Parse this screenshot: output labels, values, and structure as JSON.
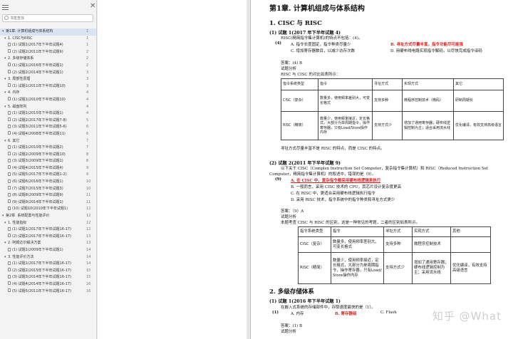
{
  "sidebar": {
    "search_placeholder": "书签查找",
    "toc": [
      {
        "label": "第1章. 计算机组成与体系结构",
        "page": "1",
        "level": 0,
        "tw": "▾",
        "selected": true
      },
      {
        "label": "1. CISC与RISC",
        "page": "1",
        "level": 1,
        "tw": "▾"
      },
      {
        "label": "(1) 试题1(2017年下半年试题4)",
        "page": "1",
        "level": 2
      },
      {
        "label": "(2) 试题2(2011年下半年试题9)",
        "page": "2",
        "level": 2
      },
      {
        "label": "2. 多级存储体系",
        "page": "2",
        "level": 1,
        "tw": "▾"
      },
      {
        "label": "(1) 试题1(2016年下半年试题1)",
        "page": "2",
        "level": 2
      },
      {
        "label": "(2) 试题2(2014年下半年试题1)",
        "page": "3",
        "level": 2
      },
      {
        "label": "3. 局部性原理",
        "page": "3",
        "level": 1,
        "tw": "▾"
      },
      {
        "label": "(1) 试题1(2011年下半年试题10)",
        "page": "3",
        "level": 2
      },
      {
        "label": "4. 内存",
        "page": "4",
        "level": 1,
        "tw": "▾"
      },
      {
        "label": "(1) 试题1(2010年下半年试题10)",
        "page": "4",
        "level": 2
      },
      {
        "label": "5. 磁盘阵列",
        "page": "4",
        "level": 1,
        "tw": "▾"
      },
      {
        "label": "(1) 试题1(2015年下半年试题1)",
        "page": "4",
        "level": 2
      },
      {
        "label": "(2) 试题2(2017年下半年试题7-8)",
        "page": "5",
        "level": 2
      },
      {
        "label": "(3) 试题3(2011年下半年试题5-6)",
        "page": "6",
        "level": 2
      },
      {
        "label": "(4) 试题4(2008年下半年试题11)",
        "page": "6",
        "level": 2
      },
      {
        "label": "6. 其它",
        "page": "7",
        "level": 1,
        "tw": "▾"
      },
      {
        "label": "(1) 试题1(2010年下半年试题2)",
        "page": "7",
        "level": 2
      },
      {
        "label": "(2) 试题2(2009年下半年试题10)",
        "page": "8",
        "level": 2
      },
      {
        "label": "(3) 试题3(2009年下半年试题1)",
        "page": "8",
        "level": 2
      },
      {
        "label": "(4) 试题4(2015年下半年试题4)",
        "page": "9",
        "level": 2
      },
      {
        "label": "(5) 试题5(2017年下半年试题1-2)",
        "page": "9",
        "level": 2
      },
      {
        "label": "(6) 试题6(2016年下半年试题1)",
        "page": "10",
        "level": 2
      },
      {
        "label": "(7) 试题7(2015年下半年试题3)",
        "page": "10",
        "level": 2
      },
      {
        "label": "(8) 试题8(2009年下半年试题9)",
        "page": "11",
        "level": 2
      },
      {
        "label": "(9) 试题9(2014年下半年试题1)",
        "page": "11",
        "level": 2
      },
      {
        "label": "(10) 试题10(2010年下半年试题1)",
        "page": "12",
        "level": 2
      },
      {
        "label": "第2章. 系统配置与性能评价",
        "page": "12",
        "level": 0,
        "tw": "▾"
      },
      {
        "label": "1. 性能指标",
        "page": "12",
        "level": 1,
        "tw": "▾"
      },
      {
        "label": "(1) 试题1(2017年下半年试题16-17)",
        "page": "12",
        "level": 2
      },
      {
        "label": "(2) 试题2(2017年下半年试题16-17)",
        "page": "13",
        "level": 2
      },
      {
        "label": "2. 阿姆达尔解决方案",
        "page": "13",
        "level": 1,
        "tw": "▾"
      },
      {
        "label": "(1) 试题1(2009年下半年试题1)",
        "page": "14",
        "level": 2
      },
      {
        "label": "3. 性能评价方法",
        "page": "14",
        "level": 1,
        "tw": "▾"
      },
      {
        "label": "(1) 试题1(2017年下半年试题16-17)",
        "page": "14",
        "level": 2
      },
      {
        "label": "(2) 试题2(2015年下半年试题16-17)",
        "page": "15",
        "level": 2
      },
      {
        "label": "(3) 试题3(2014年下半年试题16-17)",
        "page": "15",
        "level": 2
      },
      {
        "label": "(4) 试题4(2014年下半年试题16-17)",
        "page": "16",
        "level": 2
      },
      {
        "label": "(5) 试题5(2011年下半年试题16-17)",
        "page": "16",
        "level": 2
      }
    ]
  },
  "doc": {
    "chapter": "第1章. 计算机组成与体系结构",
    "s1_title": "1. CISC 与 RISC",
    "q1_title": "(1) 试题 1(2017 年下半年试题 4)",
    "q1_stem": "RISC(精简指令集计算机)的特点不包括：(4)。",
    "q1_num": "(4)",
    "q1_a": "A. 指令长度固定，指令种类尽量少",
    "q1_b": "B. 寻址方式尽量丰富，指令功能尽可能强",
    "q1_c": "C. 增加寄存器数目，以减少访存次数",
    "q1_d": "D. 用硬布线电路实现指令解码，以尽快完成指令译码",
    "q1_answer": "答案：(4) B",
    "q1_analysis": "试题分析",
    "q1_intro": "RISC 与 CISC 的对比如表所示：",
    "t1_header": [
      "指令系统类型",
      "指令",
      "寻址方式",
      "实现方式",
      "其它"
    ],
    "t1_rows": [
      [
        "CISC（复杂）",
        "数量多，使用频率差别大，可变长格式",
        "支持多种",
        "微程序控制技术（微码）",
        "研制周期长"
      ],
      [
        "RISC（精简）",
        "数量少，使用频率接近，定长格式，大部分为单周期指令，操作寄存器，只有Load/Store操作内存",
        "支持方式少",
        "增加了通用寄存器；硬布线逻辑控制为主；适合采用流水线",
        "优化编译，有效支持高级语言"
      ]
    ],
    "q1_note": "寻址方式尽量丰富不是 RISC 的特点，而是 CISC 的特点。",
    "q2_title": "(2) 试题 2(2011 年下半年试题 9)",
    "q2_stem1": "以下关于 CISC（Complex Instruction Set Computer，复杂指令集计算机）和 RISC（Reduced Instruction Set",
    "q2_stem2": "Computer，精简指令集计算机）的叙述中，错误的是（9）。",
    "q2_num": "(9)",
    "q2_a": "A. 在 CISC 中，复杂指令都采用硬布线逻辑来执行",
    "q2_b": "B. 一般而言，采用 CISC 技术的 CPU，其芯片设计复杂度更高",
    "q2_c": "C. 在 RISC 中，更适合采用硬布线逻辑执行指令",
    "q2_d": "D. 采用 RISC 技术，指令系统中的指令种类和寻址方式更少",
    "q2_answer": "答案：（9）A",
    "q2_analysis": "试题分析",
    "q2_intro": "本题考查 CISC 与 RISC 的区别，这是一种常见的考题，二者的区别如表所示。",
    "t2_header": [
      "指令系统类型",
      "指令",
      "寻址方式",
      "实现方式",
      "其他"
    ],
    "t2_rows": [
      [
        "CISC（复杂）",
        "数量多，使用频率差别大，可变长格式",
        "支持多种",
        "微程序控制技术",
        ""
      ],
      [
        "RISC（精简）",
        "数量少，使用频率接近，定长格式，大部分为单周期指令，操作寄存器，只有Load/Store操作内存",
        "支持方式少",
        "增加了通用寄存器；硬布线逻辑控制为主；采用流水线",
        "优化编译，有效支持高级语言"
      ]
    ],
    "s2_title": "2. 多级存储体系",
    "q3_title": "(1) 试题 1(2016 年下半年试题 1)",
    "q3_stem": "在嵌入式系统的存储部件中，存取速度最快的是（1）。",
    "q3_num": "(1)",
    "q3_a": "A. 内存",
    "q3_b": "B. 寄存器组",
    "q3_c": "C. Flash",
    "q3_answer": "答案：(1) B",
    "q3_analysis": "试题分析"
  },
  "watermark": "知乎 @What"
}
